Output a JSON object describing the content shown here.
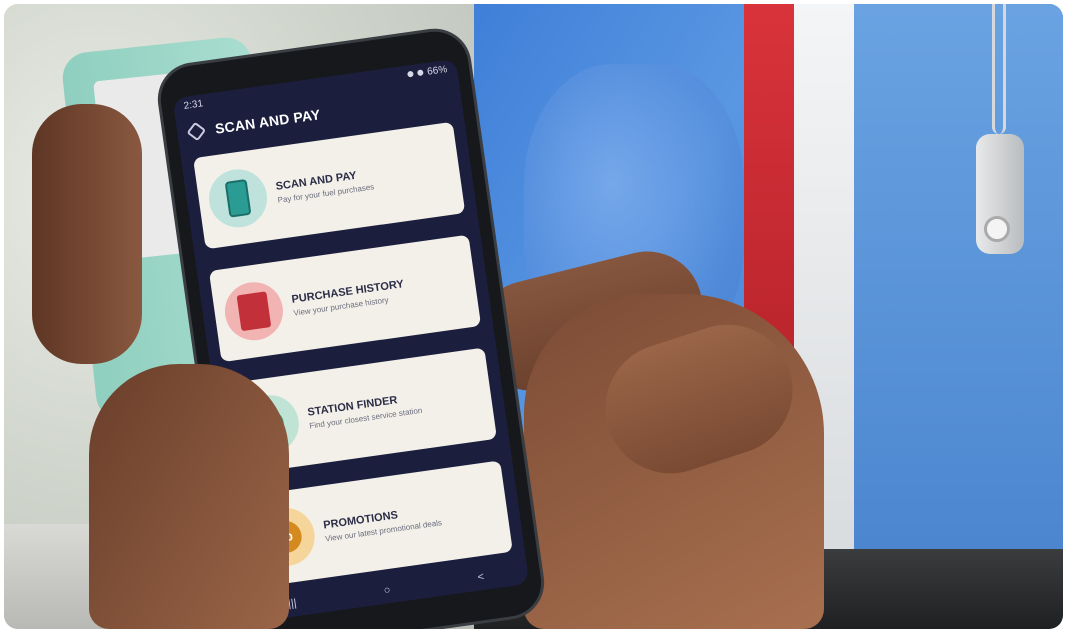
{
  "phone": {
    "status_time": "2:31",
    "status_battery": "66%",
    "app_title": "SCAN AND PAY",
    "menu": [
      {
        "title": "SCAN AND PAY",
        "subtitle": "Pay for your fuel purchases",
        "icon": "phone-scan-icon"
      },
      {
        "title": "PURCHASE HISTORY",
        "subtitle": "View your purchase history",
        "icon": "receipt-icon"
      },
      {
        "title": "STATION FINDER",
        "subtitle": "Find your closest service station",
        "icon": "map-pin-icon"
      },
      {
        "title": "PROMOTIONS",
        "subtitle": "View our latest promotional deals",
        "icon": "percent-badge-icon"
      }
    ],
    "promo_badge_symbol": "%",
    "nav": [
      "|||",
      "○",
      "<"
    ]
  },
  "colors": {
    "screen_bg": "#1b1f3d",
    "card_bg": "#f3f0ea",
    "jacket_blue": "#4b86d4",
    "stripe_red": "#d9333b"
  }
}
